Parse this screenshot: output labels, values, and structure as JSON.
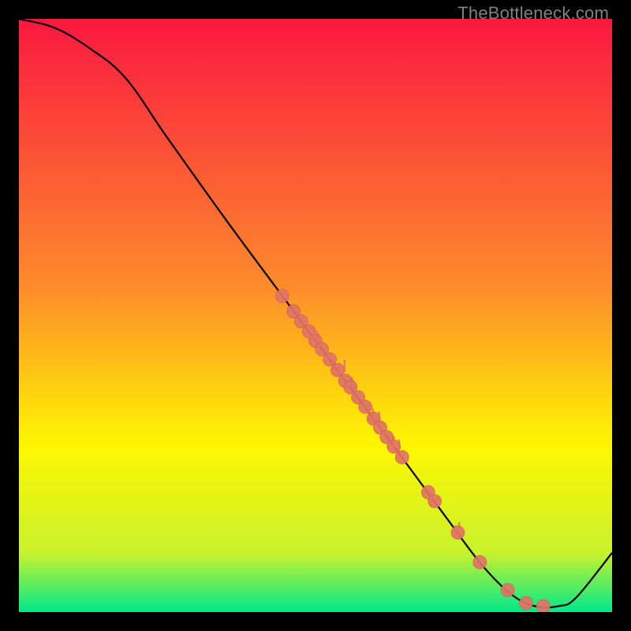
{
  "watermark": "TheBottleneck.com",
  "colors": {
    "gradient_top": "#fb1840",
    "gradient_mid1": "#fd8b2c",
    "gradient_mid2": "#fef600",
    "gradient_mid3": "#c9f22c",
    "gradient_bottom": "#00e88b",
    "line": "#000000",
    "point_fill": "#e17366",
    "point_stroke": "#d55a4d",
    "frame": "#000000"
  },
  "chart_data": {
    "type": "line",
    "title": "",
    "xlabel": "",
    "ylabel": "",
    "xlim": [
      0,
      100
    ],
    "ylim": [
      0,
      100
    ],
    "axes_visible": false,
    "grid": false,
    "curve": [
      {
        "x": 0,
        "y": 100
      },
      {
        "x": 6,
        "y": 98.5
      },
      {
        "x": 12,
        "y": 95
      },
      {
        "x": 18,
        "y": 90
      },
      {
        "x": 25,
        "y": 80
      },
      {
        "x": 35,
        "y": 66
      },
      {
        "x": 45,
        "y": 52.5
      },
      {
        "x": 55,
        "y": 39
      },
      {
        "x": 65,
        "y": 25.5
      },
      {
        "x": 72,
        "y": 16
      },
      {
        "x": 78,
        "y": 8
      },
      {
        "x": 83,
        "y": 3
      },
      {
        "x": 87,
        "y": 1
      },
      {
        "x": 91,
        "y": 1
      },
      {
        "x": 94,
        "y": 2.5
      },
      {
        "x": 100,
        "y": 10
      }
    ],
    "scatter_points": [
      {
        "x": 44.4,
        "y": 53.3
      },
      {
        "x": 46.3,
        "y": 50.7
      },
      {
        "x": 47.6,
        "y": 49.0
      },
      {
        "x": 48.9,
        "y": 47.3
      },
      {
        "x": 50.0,
        "y": 45.7
      },
      {
        "x": 51.1,
        "y": 44.3
      },
      {
        "x": 52.4,
        "y": 42.6
      },
      {
        "x": 53.7,
        "y": 40.8
      },
      {
        "x": 55.0,
        "y": 39.0
      },
      {
        "x": 55.9,
        "y": 37.9
      },
      {
        "x": 57.2,
        "y": 36.2
      },
      {
        "x": 58.4,
        "y": 34.6
      },
      {
        "x": 59.8,
        "y": 32.6
      },
      {
        "x": 60.9,
        "y": 31.1
      },
      {
        "x": 62.0,
        "y": 29.5
      },
      {
        "x": 63.2,
        "y": 27.9
      },
      {
        "x": 64.6,
        "y": 26.1
      },
      {
        "x": 69.0,
        "y": 20.2
      },
      {
        "x": 70.1,
        "y": 18.7
      },
      {
        "x": 74.0,
        "y": 13.4
      },
      {
        "x": 77.7,
        "y": 8.4
      },
      {
        "x": 82.4,
        "y": 3.7
      },
      {
        "x": 85.5,
        "y": 1.5
      },
      {
        "x": 88.4,
        "y": 1.0
      }
    ],
    "scatter_jitter_series": [
      {
        "x": 50.0,
        "y": 45.7,
        "count": 3
      },
      {
        "x": 53.7,
        "y": 40.8,
        "count": 4
      },
      {
        "x": 55.9,
        "y": 37.9,
        "count": 3
      },
      {
        "x": 59.8,
        "y": 32.6,
        "count": 3
      },
      {
        "x": 63.2,
        "y": 27.9,
        "count": 3
      },
      {
        "x": 74.0,
        "y": 13.4,
        "count": 2
      }
    ]
  }
}
